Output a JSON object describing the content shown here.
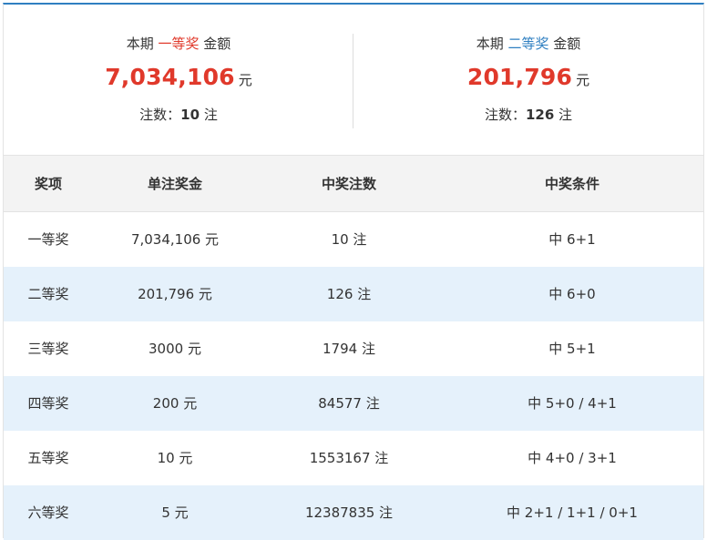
{
  "summary": {
    "first": {
      "prefix": "本期",
      "prize": "一等奖",
      "suffix": "金额",
      "amount": "7,034,106",
      "unit": "元",
      "count_label": "注数：",
      "count": "10",
      "count_unit": "注"
    },
    "second": {
      "prefix": "本期",
      "prize": "二等奖",
      "suffix": "金额",
      "amount": "201,796",
      "unit": "元",
      "count_label": "注数：",
      "count": "126",
      "count_unit": "注"
    }
  },
  "table": {
    "headers": [
      "奖项",
      "单注奖金",
      "中奖注数",
      "中奖条件"
    ],
    "rows": [
      [
        "一等奖",
        "7,034,106 元",
        "10 注",
        "中 6+1"
      ],
      [
        "二等奖",
        "201,796 元",
        "126 注",
        "中 6+0"
      ],
      [
        "三等奖",
        "3000 元",
        "1794 注",
        "中 5+1"
      ],
      [
        "四等奖",
        "200 元",
        "84577 注",
        "中 5+0 / 4+1"
      ],
      [
        "五等奖",
        "10 元",
        "1553167 注",
        "中 4+0 / 3+1"
      ],
      [
        "六等奖",
        "5 元",
        "12387835 注",
        "中 2+1 / 1+1 / 0+1"
      ]
    ]
  },
  "colors": {
    "accent_red": "#e0392b",
    "accent_blue": "#2f7fc1",
    "row_alt": "#e5f1fb",
    "header_bg": "#f3f3f3"
  }
}
